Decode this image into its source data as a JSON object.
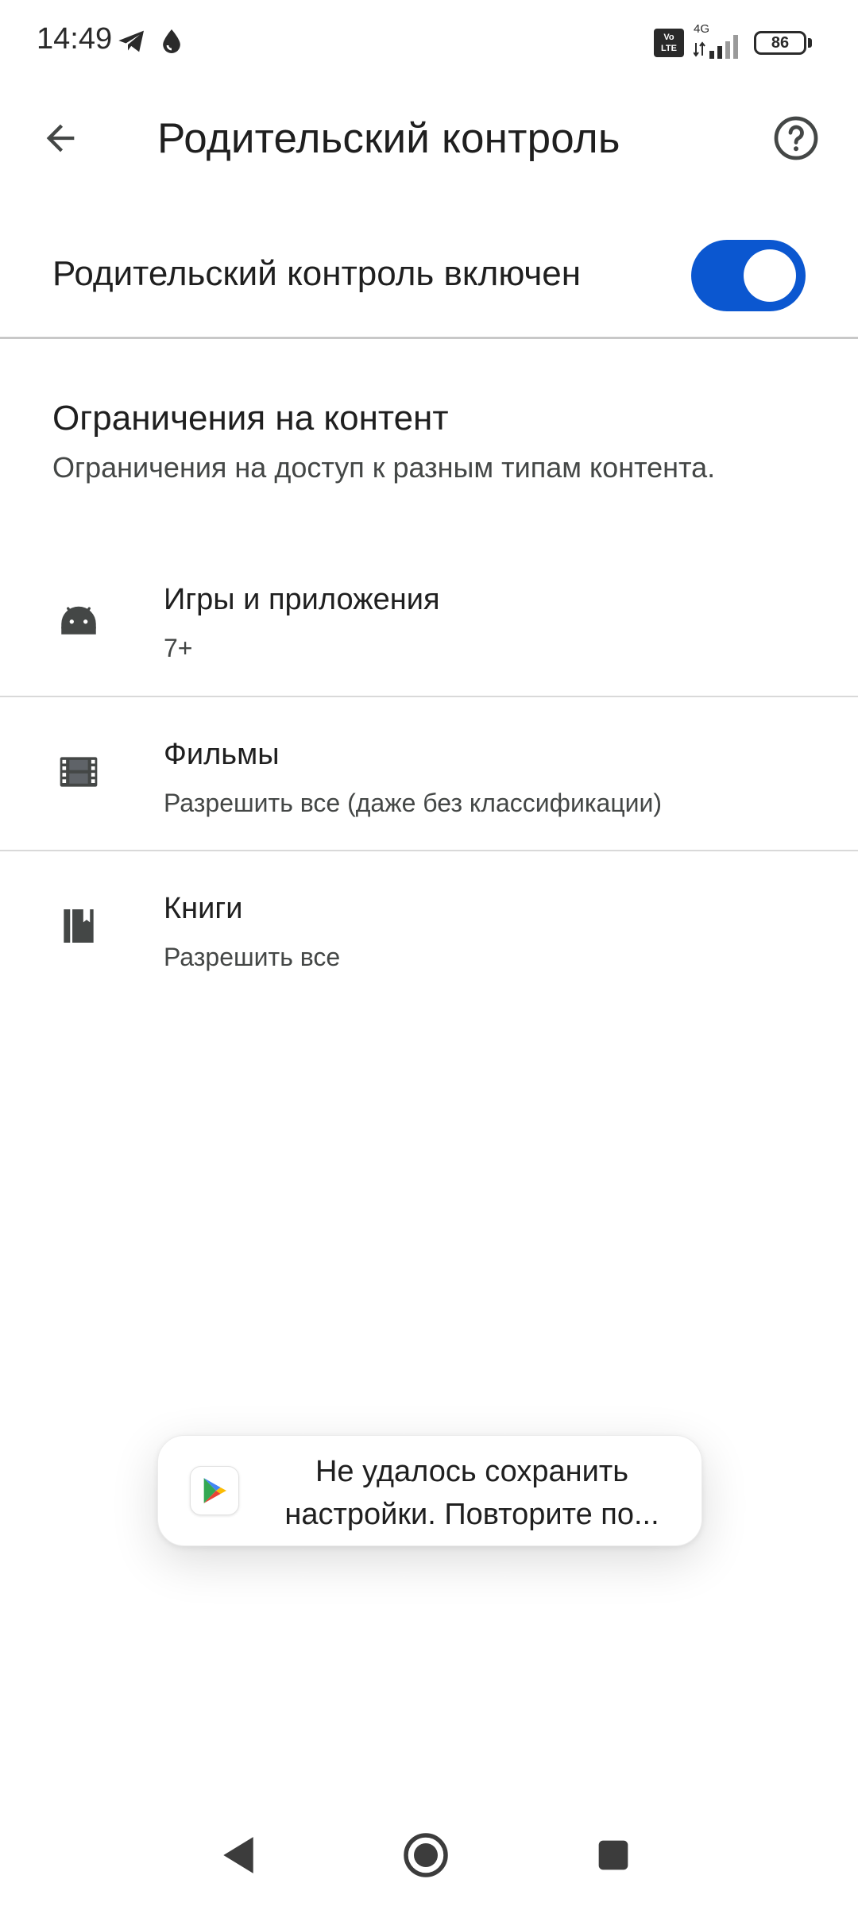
{
  "status_bar": {
    "time": "14:49",
    "network_type": "4G",
    "volte_line1": "Vo",
    "volte_line2": "LTE",
    "battery": "86"
  },
  "toolbar": {
    "title": "Родительский контроль",
    "back_icon": "arrow-back-icon",
    "help_icon": "help-circle-icon"
  },
  "master_toggle": {
    "label": "Родительский контроль включен",
    "state": "on",
    "color": "#0b57d0"
  },
  "content_section": {
    "title": "Ограничения на контент",
    "description": "Ограничения на доступ к разным типам контента."
  },
  "items": [
    {
      "icon": "android-icon",
      "title": "Игры и приложения",
      "subtitle": "7+"
    },
    {
      "icon": "movie-film-icon",
      "title": "Фильмы",
      "subtitle": "Разрешить все (даже без классификации)"
    },
    {
      "icon": "book-icon",
      "title": "Книги",
      "subtitle": "Разрешить все"
    }
  ],
  "toast": {
    "app_icon": "google-play-icon",
    "line1": "Не удалось сохранить",
    "line2": "настройки. Повторите по..."
  },
  "nav_bar": {
    "back_icon": "nav-back-icon",
    "home_icon": "nav-home-icon",
    "recents_icon": "nav-recents-icon"
  }
}
